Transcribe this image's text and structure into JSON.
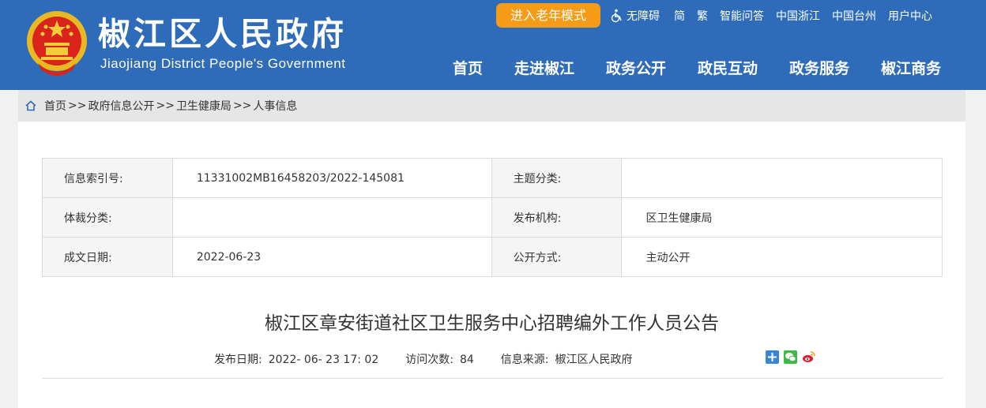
{
  "header": {
    "title": "椒江区人民政府",
    "subtitle": "Jiaojiang District People's Government",
    "elder_mode": "进入老年模式",
    "top_links": [
      "无障碍",
      "简",
      "繁",
      "智能问答",
      "中国浙江",
      "中国台州",
      "用户中心"
    ],
    "nav": [
      "首页",
      "走进椒江",
      "政务公开",
      "政民互动",
      "政务服务",
      "椒江商务"
    ],
    "colors": {
      "bar": "#2e6cba",
      "elder_button": "#f59b16"
    }
  },
  "breadcrumb": {
    "items": [
      "首页",
      "政府信息公开",
      "卫生健康局",
      "人事信息"
    ],
    "separator": ">>"
  },
  "meta": {
    "index_label": "信息索引号:",
    "index_value": "11331002MB16458203/2022-145081",
    "topic_label": "主题分类:",
    "topic_value": "",
    "genre_label": "体裁分类:",
    "genre_value": "",
    "publisher_label": "发布机构:",
    "publisher_value": "区卫生健康局",
    "date_label": "成文日期:",
    "date_value": "2022-06-23",
    "mode_label": "公开方式:",
    "mode_value": "主动公开"
  },
  "article": {
    "title": "椒江区章安街道社区卫生服务中心招聘编外工作人员公告",
    "pub_label": "发布日期:",
    "pub_value": "2022- 06- 23 17: 02",
    "visits_label": "访问次数:",
    "visits_value": "84",
    "source_label": "信息来源:",
    "source_value": "椒江区人民政府"
  },
  "share": [
    "share-plus-icon",
    "wechat-icon",
    "weibo-icon"
  ]
}
